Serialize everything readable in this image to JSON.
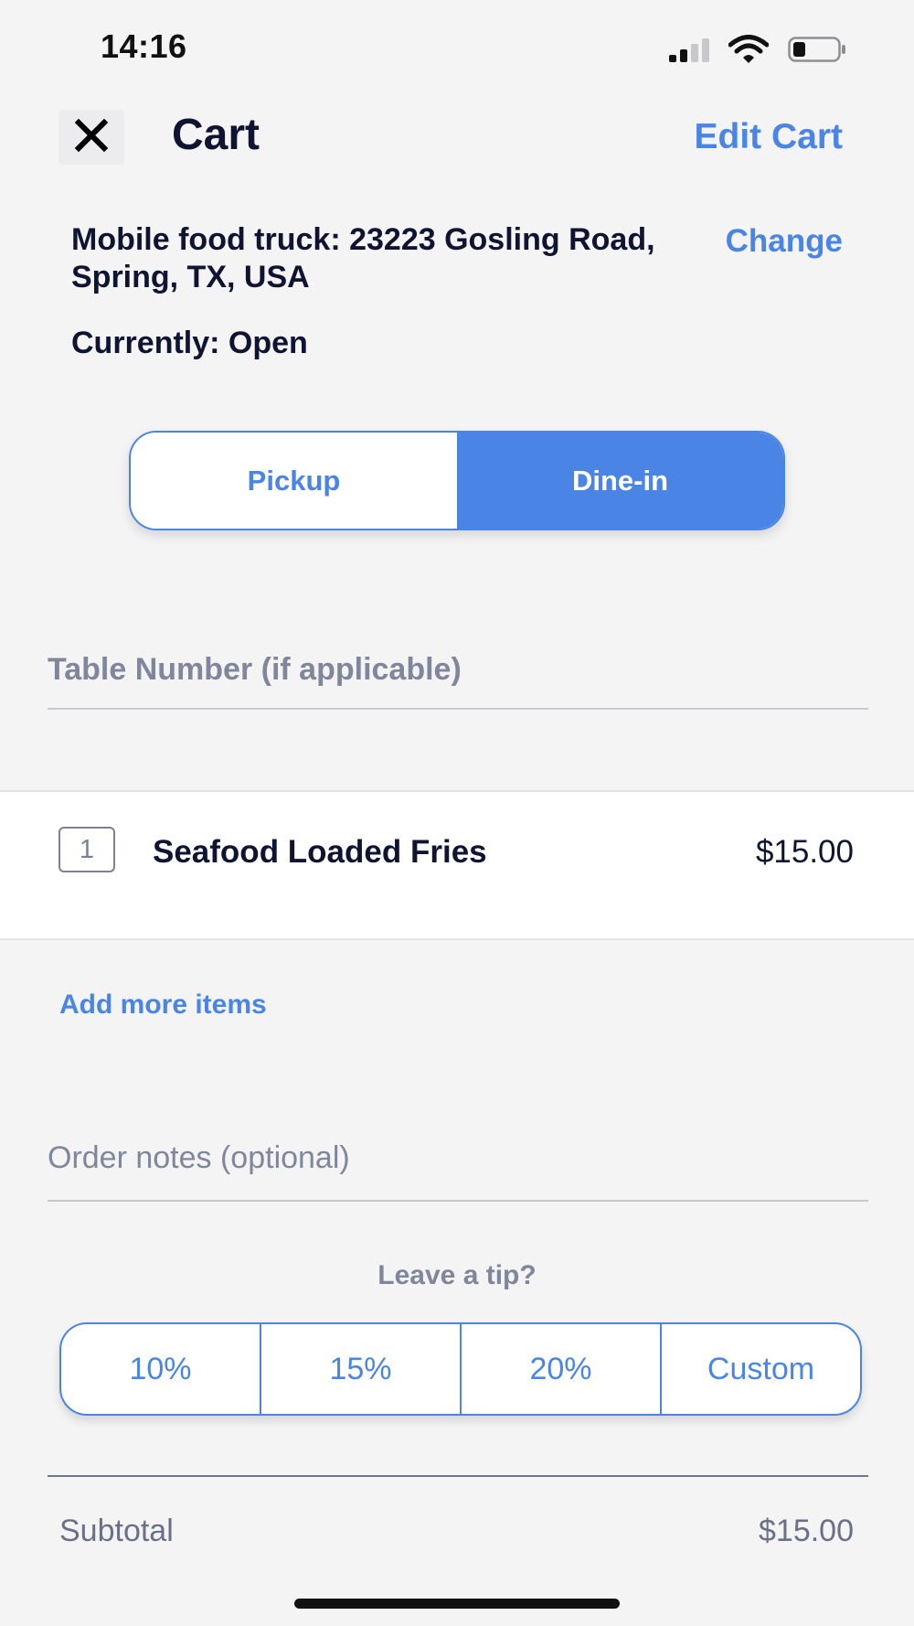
{
  "status_bar": {
    "time": "14:16"
  },
  "header": {
    "title": "Cart",
    "edit_label": "Edit Cart"
  },
  "location": {
    "address": "Mobile food truck: 23223 Gosling Road, Spring, TX, USA",
    "change_label": "Change",
    "status": "Currently: Open"
  },
  "order_type": {
    "options": [
      "Pickup",
      "Dine-in"
    ],
    "selected": "Dine-in"
  },
  "table_number": {
    "placeholder": "Table Number (if applicable)",
    "value": ""
  },
  "cart_items": [
    {
      "quantity": "1",
      "name": "Seafood Loaded Fries",
      "price": "$15.00"
    }
  ],
  "add_more_label": "Add more items",
  "notes": {
    "placeholder": "Order notes (optional)",
    "value": ""
  },
  "tip": {
    "label": "Leave a tip?",
    "options": [
      "10%",
      "15%",
      "20%",
      "Custom"
    ]
  },
  "summary": {
    "subtotal_label": "Subtotal",
    "subtotal_value": "$15.00"
  },
  "colors": {
    "accent": "#4a85e6",
    "text_primary": "#0f1433",
    "text_muted": "#80869b",
    "background": "#f4f4f5"
  }
}
